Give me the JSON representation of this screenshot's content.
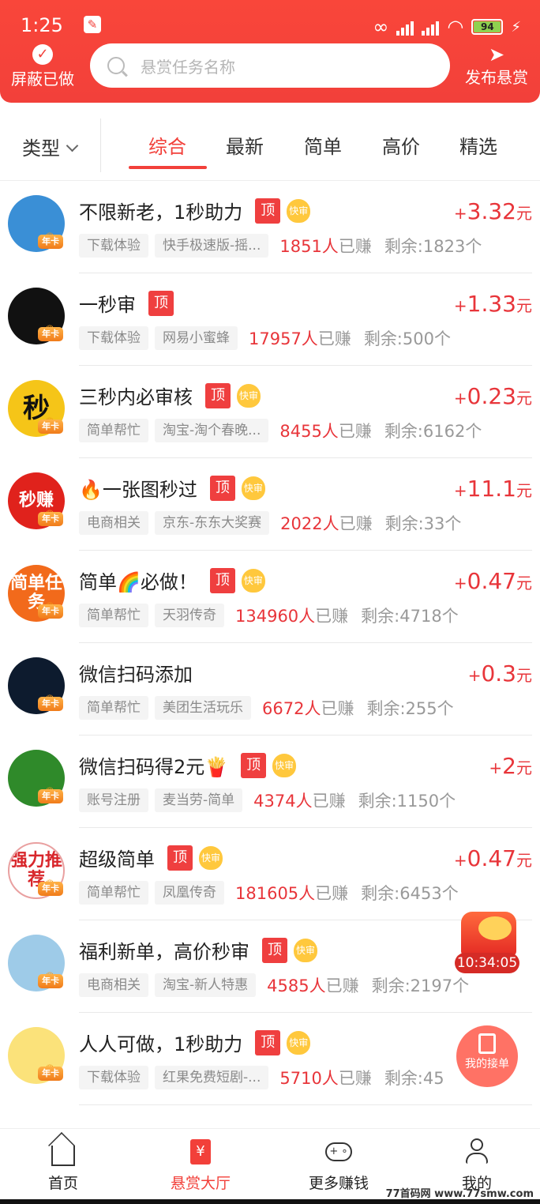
{
  "status_bar": {
    "time": "1:25",
    "battery": "94"
  },
  "header": {
    "hide_done_label": "屏蔽已做",
    "search_placeholder": "悬赏任务名称",
    "publish_label": "发布悬赏"
  },
  "filter": {
    "type_label": "类型",
    "tabs": [
      "综合",
      "最新",
      "简单",
      "高价",
      "精选"
    ],
    "active_tab": "综合"
  },
  "badges": {
    "top": "顶",
    "fast": "快审",
    "vip": "年卡"
  },
  "tasks": [
    {
      "title": "不限新老，1秒助力",
      "top": true,
      "fast": true,
      "price": "3.32",
      "category": "下载体验",
      "app": "快手极速版-摇...",
      "earned": "1851人",
      "remaining": "剩余:1823个",
      "avatar_text": "",
      "avatar_bg": "#3a8fd6"
    },
    {
      "title": "一秒审",
      "top": true,
      "fast": false,
      "price": "1.33",
      "category": "下载体验",
      "app": "网易小蜜蜂",
      "earned": "17957人",
      "remaining": "剩余:500个",
      "avatar_text": "",
      "avatar_bg": "#111111"
    },
    {
      "title": "三秒内必审核",
      "top": true,
      "fast": true,
      "price": "0.23",
      "category": "简单帮忙",
      "app": "淘宝-淘个春晚...",
      "earned": "8455人",
      "remaining": "剩余:6162个",
      "avatar_text": "秒",
      "avatar_bg": "#f5c518"
    },
    {
      "title": "🔥一张图秒过",
      "top": true,
      "fast": true,
      "price": "11.1",
      "category": "电商相关",
      "app": "京东-东东大奖赛",
      "earned": "2022人",
      "remaining": "剩余:33个",
      "avatar_text": "秒赚",
      "avatar_bg": "#e0221c"
    },
    {
      "title": "简单🌈必做！",
      "top": true,
      "fast": true,
      "price": "0.47",
      "category": "简单帮忙",
      "app": "天羽传奇",
      "earned": "134960人",
      "remaining": "剩余:4718个",
      "avatar_text": "简单任务",
      "avatar_bg": "#f26a1b"
    },
    {
      "title": "微信扫码添加",
      "top": false,
      "fast": false,
      "price": "0.3",
      "category": "简单帮忙",
      "app": "美团生活玩乐",
      "earned": "6672人",
      "remaining": "剩余:255个",
      "avatar_text": "",
      "avatar_bg": "#0d1b2e"
    },
    {
      "title": "微信扫码得2元🍟",
      "top": true,
      "fast": true,
      "price": "2",
      "category": "账号注册",
      "app": "麦当劳-简单",
      "earned": "4374人",
      "remaining": "剩余:1150个",
      "avatar_text": "",
      "avatar_bg": "#2f8a2a"
    },
    {
      "title": "超级简单",
      "top": true,
      "fast": true,
      "price": "0.47",
      "category": "简单帮忙",
      "app": "凤凰传奇",
      "earned": "181605人",
      "remaining": "剩余:6453个",
      "avatar_text": "强力推荐",
      "avatar_bg": "#ffffff"
    },
    {
      "title": "福利新单，高价秒审",
      "top": true,
      "fast": true,
      "price": "",
      "category": "电商相关",
      "app": "淘宝-新人特惠",
      "earned": "4585人",
      "remaining": "剩余:2197个",
      "avatar_text": "",
      "avatar_bg": "#9ecbe8"
    },
    {
      "title": "人人可做，1秒助力",
      "top": true,
      "fast": true,
      "price": "",
      "category": "下载体验",
      "app": "红果免费短剧-...",
      "earned": "5710人",
      "remaining": "剩余:45",
      "avatar_text": "",
      "avatar_bg": "#fbe27a"
    }
  ],
  "earned_suffix": "已赚",
  "price_unit": "元",
  "price_plus": "+",
  "floating": {
    "redpack_timer": "10:34:05",
    "my_orders_label": "我的接单"
  },
  "bottom_nav": [
    {
      "label": "首页",
      "active": false
    },
    {
      "label": "悬赏大厅",
      "active": true
    },
    {
      "label": "更多赚钱",
      "active": false
    },
    {
      "label": "我的",
      "active": false
    }
  ],
  "watermark": "77首码网 www.77smw.com",
  "colors": {
    "primary": "#f2403a",
    "price": "#e8353a",
    "tag_bg": "#f4f4f4",
    "fast_badge": "#ffc83d",
    "vip_badge": "#f07b1a"
  }
}
